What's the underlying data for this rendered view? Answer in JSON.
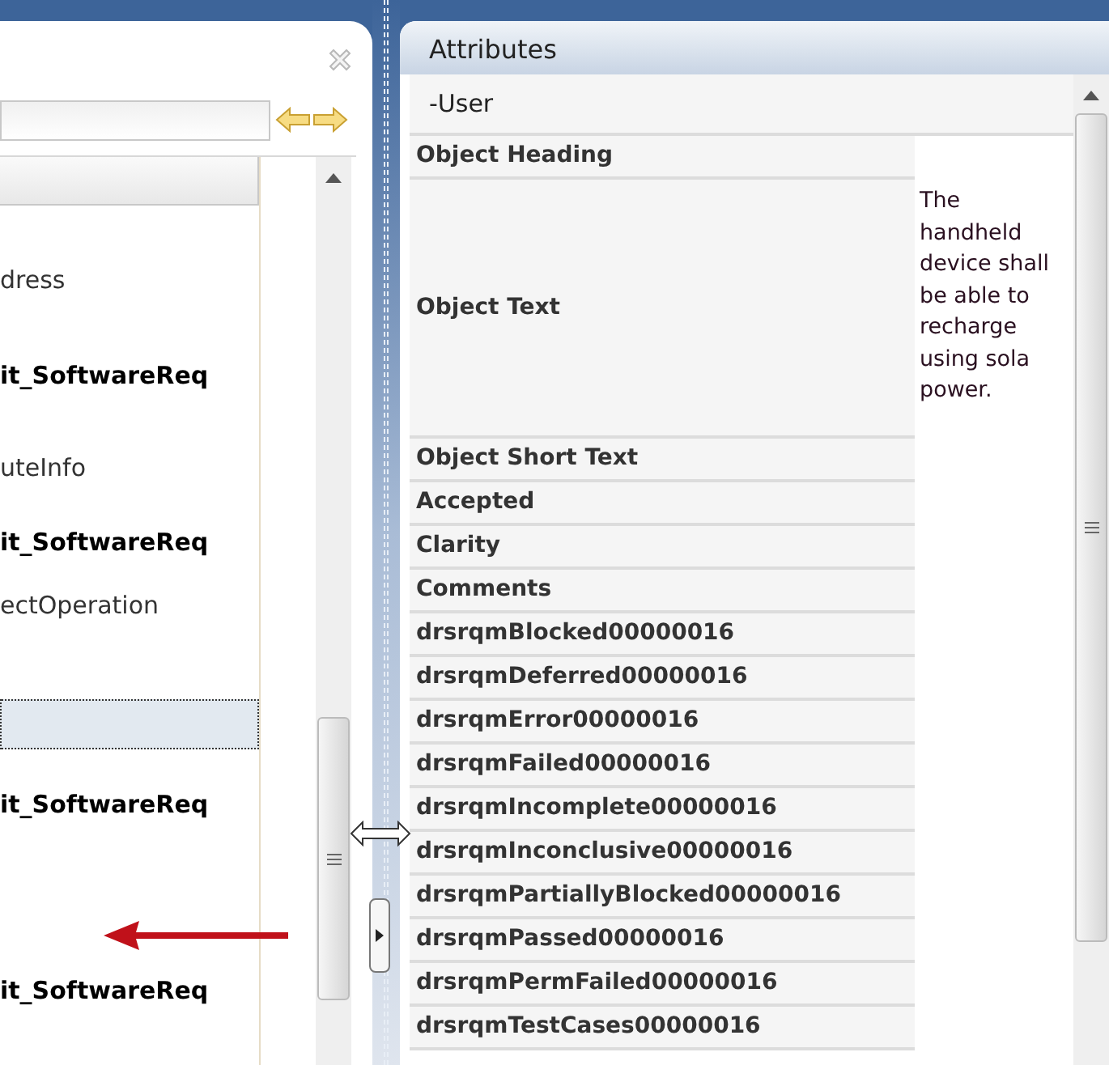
{
  "left_panel": {
    "rows": [
      {
        "text": "dress",
        "bold": false,
        "selected": false
      },
      {
        "text": "it_SoftwareReq",
        "bold": true,
        "selected": false
      },
      {
        "text": "uteInfo",
        "bold": false,
        "selected": false
      },
      {
        "text": "it_SoftwareReq",
        "bold": true,
        "selected": false
      },
      {
        "text": "ectOperation",
        "bold": false,
        "selected": false
      },
      {
        "selected": true
      },
      {
        "text": "it_SoftwareReq",
        "bold": true,
        "selected": false
      },
      {
        "text": "it_SoftwareReq",
        "bold": true,
        "selected": false
      }
    ]
  },
  "attributes": {
    "title": "Attributes",
    "group": "-User",
    "rows": [
      {
        "label": "Object Heading"
      },
      {
        "label": "Object Text",
        "value": "The handheld device shall be able to recharge using sola power."
      },
      {
        "label": "Object Short Text"
      },
      {
        "label": "Accepted"
      },
      {
        "label": "Clarity"
      },
      {
        "label": "Comments"
      },
      {
        "label": "drsrqmBlocked00000016"
      },
      {
        "label": "drsrqmDeferred00000016"
      },
      {
        "label": "drsrqmError00000016"
      },
      {
        "label": "drsrqmFailed00000016"
      },
      {
        "label": "drsrqmIncomplete00000016"
      },
      {
        "label": "drsrqmInconclusive00000016"
      },
      {
        "label": "drsrqmPartiallyBlocked00000016"
      },
      {
        "label": "drsrqmPassed00000016"
      },
      {
        "label": "drsrqmPermFailed00000016"
      },
      {
        "label": "drsrqmTestCases00000016"
      }
    ]
  }
}
